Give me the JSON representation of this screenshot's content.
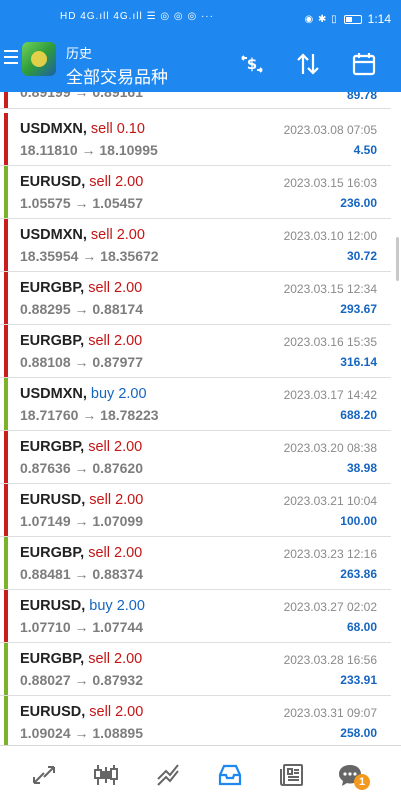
{
  "statusbar": {
    "signal_left": "HD 4G.ıll 4G.ıll",
    "signal_icons": "☰ ◎ ◎ ◎ ···",
    "right_icons": "◉ ✱ ▯",
    "time": "1:14"
  },
  "toolbar": {
    "title": "历史",
    "subtitle": "全部交易品种",
    "icons": [
      "menu-icon",
      "currency-exchange-icon",
      "sort-icon",
      "calendar-icon"
    ]
  },
  "trades": {
    "partial": {
      "prices": "0.89199 → 0.89161",
      "pl": "89.78",
      "result": "loss"
    },
    "rows": [
      {
        "symbol": "USDMXN,",
        "side": "sell 0.10",
        "side_type": "sell",
        "prices": "18.11810 → 18.10995",
        "time": "2023.03.08 07:05",
        "pl": "4.50",
        "result": "loss"
      },
      {
        "symbol": "EURUSD,",
        "side": "sell 2.00",
        "side_type": "sell",
        "prices": "1.05575 → 1.05457",
        "time": "2023.03.15 16:03",
        "pl": "236.00",
        "result": "profit"
      },
      {
        "symbol": "USDMXN,",
        "side": "sell 2.00",
        "side_type": "sell",
        "prices": "18.35954 → 18.35672",
        "time": "2023.03.10 12:00",
        "pl": "30.72",
        "result": "loss"
      },
      {
        "symbol": "EURGBP,",
        "side": "sell 2.00",
        "side_type": "sell",
        "prices": "0.88295 → 0.88174",
        "time": "2023.03.15 12:34",
        "pl": "293.67",
        "result": "loss"
      },
      {
        "symbol": "EURGBP,",
        "side": "sell 2.00",
        "side_type": "sell",
        "prices": "0.88108 → 0.87977",
        "time": "2023.03.16 15:35",
        "pl": "316.14",
        "result": "loss"
      },
      {
        "symbol": "USDMXN,",
        "side": "buy 2.00",
        "side_type": "buy",
        "prices": "18.71760 → 18.78223",
        "time": "2023.03.17 14:42",
        "pl": "688.20",
        "result": "profit"
      },
      {
        "symbol": "EURGBP,",
        "side": "sell 2.00",
        "side_type": "sell",
        "prices": "0.87636 → 0.87620",
        "time": "2023.03.20 08:38",
        "pl": "38.98",
        "result": "loss"
      },
      {
        "symbol": "EURUSD,",
        "side": "sell 2.00",
        "side_type": "sell",
        "prices": "1.07149 → 1.07099",
        "time": "2023.03.21 10:04",
        "pl": "100.00",
        "result": "loss"
      },
      {
        "symbol": "EURGBP,",
        "side": "sell 2.00",
        "side_type": "sell",
        "prices": "0.88481 → 0.88374",
        "time": "2023.03.23 12:16",
        "pl": "263.86",
        "result": "profit"
      },
      {
        "symbol": "EURUSD,",
        "side": "buy 2.00",
        "side_type": "buy",
        "prices": "1.07710 → 1.07744",
        "time": "2023.03.27 02:02",
        "pl": "68.00",
        "result": "loss"
      },
      {
        "symbol": "EURGBP,",
        "side": "sell 2.00",
        "side_type": "sell",
        "prices": "0.88027 → 0.87932",
        "time": "2023.03.28 16:56",
        "pl": "233.91",
        "result": "profit"
      },
      {
        "symbol": "EURUSD,",
        "side": "sell 2.00",
        "side_type": "sell",
        "prices": "1.09024 → 1.08895",
        "time": "2023.03.31 09:07",
        "pl": "258.00",
        "result": "profit"
      }
    ]
  },
  "bottom_nav": {
    "items": [
      "quotes-icon",
      "chart-icon",
      "trade-icon",
      "history-icon",
      "news-icon",
      "messages-icon"
    ],
    "active": "history-icon",
    "messages_badge": "1"
  },
  "colors": {
    "primary": "#1e88f0",
    "sell": "#c41414",
    "buy": "#1565c0",
    "loss_bar": "#c81e1e",
    "profit_bar": "#7cb32a",
    "nav_active": "#1e88f0",
    "nav_inactive": "#666666",
    "badge": "#f39a1e"
  }
}
